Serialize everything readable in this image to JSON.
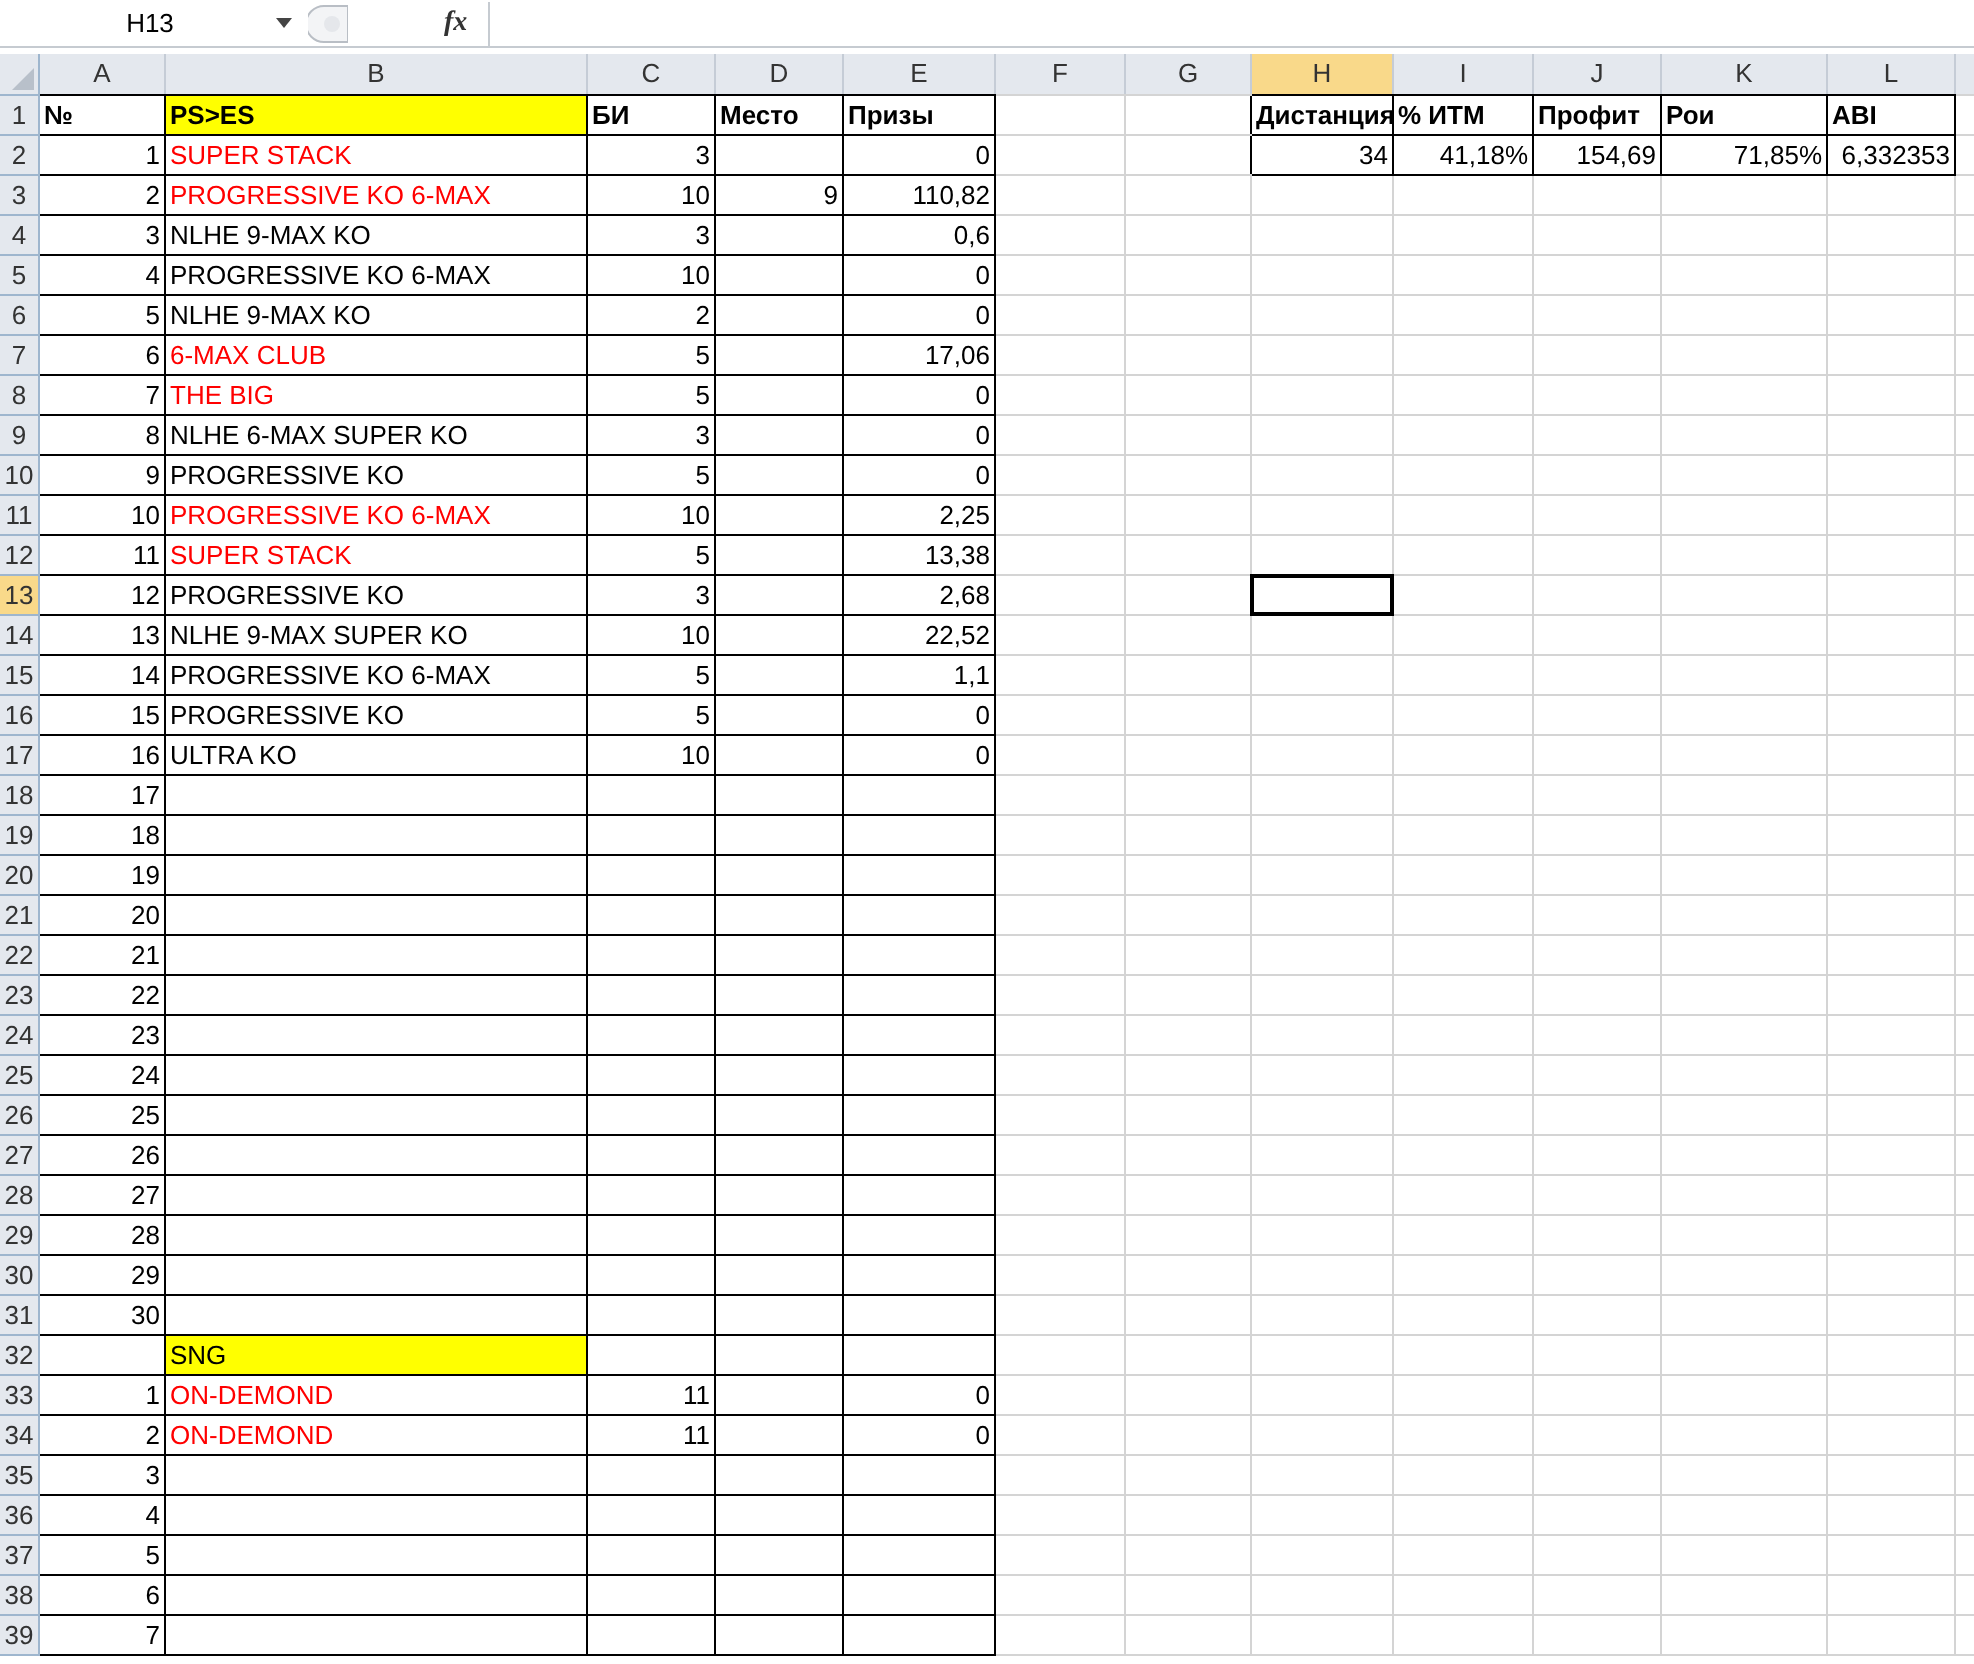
{
  "formula_bar": {
    "name_box": "H13",
    "function_label": "fx"
  },
  "columns": [
    {
      "label": "A",
      "selected": false
    },
    {
      "label": "B",
      "selected": false
    },
    {
      "label": "C",
      "selected": false
    },
    {
      "label": "D",
      "selected": false
    },
    {
      "label": "E",
      "selected": false
    },
    {
      "label": "F",
      "selected": false
    },
    {
      "label": "G",
      "selected": false
    },
    {
      "label": "H",
      "selected": true
    },
    {
      "label": "I",
      "selected": false
    },
    {
      "label": "J",
      "selected": false
    },
    {
      "label": "K",
      "selected": false
    },
    {
      "label": "L",
      "selected": false
    }
  ],
  "rows": [
    {
      "number": "1",
      "selected": false,
      "cells": [
        {
          "kind": "text",
          "text": "№",
          "bold": true
        },
        {
          "kind": "text",
          "text": "PS>ES",
          "bold": true,
          "highlighted": true
        },
        {
          "kind": "text",
          "text": "БИ",
          "bold": true
        },
        {
          "kind": "text",
          "text": "Место",
          "bold": true
        },
        {
          "kind": "text",
          "text": "Призы",
          "bold": true
        }
      ],
      "summary_cells": [
        {
          "kind": "text",
          "text": "Дистанция",
          "bold": true
        },
        {
          "kind": "text",
          "text": "% ИТМ",
          "bold": true
        },
        {
          "kind": "text",
          "text": "Профит",
          "bold": true
        },
        {
          "kind": "text",
          "text": "Рои",
          "bold": true
        },
        {
          "kind": "text",
          "text": "ABI",
          "bold": true
        }
      ]
    },
    {
      "number": "2",
      "selected": false,
      "cells": [
        {
          "kind": "number",
          "text": "1"
        },
        {
          "kind": "text",
          "text": "SUPER STACK",
          "color": "#ff0000"
        },
        {
          "kind": "number",
          "text": "3"
        },
        {
          "kind": "empty"
        },
        {
          "kind": "number",
          "text": "0"
        }
      ],
      "summary_cells": [
        {
          "kind": "number",
          "text": "34"
        },
        {
          "kind": "number",
          "text": "41,18%"
        },
        {
          "kind": "number",
          "text": "154,69"
        },
        {
          "kind": "number",
          "text": "71,85%"
        },
        {
          "kind": "number",
          "text": "6,332353"
        }
      ]
    },
    {
      "number": "3",
      "selected": false,
      "cells": [
        {
          "kind": "number",
          "text": "2"
        },
        {
          "kind": "text",
          "text": "PROGRESSIVE KO 6-MAX",
          "color": "#ff0000"
        },
        {
          "kind": "number",
          "text": "10"
        },
        {
          "kind": "number",
          "text": "9"
        },
        {
          "kind": "number",
          "text": "110,82"
        }
      ]
    },
    {
      "number": "4",
      "selected": false,
      "cells": [
        {
          "kind": "number",
          "text": "3"
        },
        {
          "kind": "text",
          "text": "NLHE 9-MAX KO"
        },
        {
          "kind": "number",
          "text": "3"
        },
        {
          "kind": "empty"
        },
        {
          "kind": "number",
          "text": "0,6"
        }
      ]
    },
    {
      "number": "5",
      "selected": false,
      "cells": [
        {
          "kind": "number",
          "text": "4"
        },
        {
          "kind": "text",
          "text": "PROGRESSIVE KO 6-MAX"
        },
        {
          "kind": "number",
          "text": "10"
        },
        {
          "kind": "empty"
        },
        {
          "kind": "number",
          "text": "0"
        }
      ]
    },
    {
      "number": "6",
      "selected": false,
      "cells": [
        {
          "kind": "number",
          "text": "5"
        },
        {
          "kind": "text",
          "text": "NLHE 9-MAX KO"
        },
        {
          "kind": "number",
          "text": "2"
        },
        {
          "kind": "empty"
        },
        {
          "kind": "number",
          "text": "0"
        }
      ]
    },
    {
      "number": "7",
      "selected": false,
      "cells": [
        {
          "kind": "number",
          "text": "6"
        },
        {
          "kind": "text",
          "text": "6-MAX CLUB",
          "color": "#ff0000"
        },
        {
          "kind": "number",
          "text": "5"
        },
        {
          "kind": "empty"
        },
        {
          "kind": "number",
          "text": "17,06"
        }
      ]
    },
    {
      "number": "8",
      "selected": false,
      "cells": [
        {
          "kind": "number",
          "text": "7"
        },
        {
          "kind": "text",
          "text": "THE BIG",
          "color": "#ff0000"
        },
        {
          "kind": "number",
          "text": "5"
        },
        {
          "kind": "empty"
        },
        {
          "kind": "number",
          "text": "0"
        }
      ]
    },
    {
      "number": "9",
      "selected": false,
      "cells": [
        {
          "kind": "number",
          "text": "8"
        },
        {
          "kind": "text",
          "text": "NLHE 6-MAX SUPER KO"
        },
        {
          "kind": "number",
          "text": "3"
        },
        {
          "kind": "empty"
        },
        {
          "kind": "number",
          "text": "0"
        }
      ]
    },
    {
      "number": "10",
      "selected": false,
      "cells": [
        {
          "kind": "number",
          "text": "9"
        },
        {
          "kind": "text",
          "text": "PROGRESSIVE KO"
        },
        {
          "kind": "number",
          "text": "5"
        },
        {
          "kind": "empty"
        },
        {
          "kind": "number",
          "text": "0"
        }
      ]
    },
    {
      "number": "11",
      "selected": false,
      "cells": [
        {
          "kind": "number",
          "text": "10"
        },
        {
          "kind": "text",
          "text": "PROGRESSIVE KO 6-MAX",
          "color": "#ff0000"
        },
        {
          "kind": "number",
          "text": "10"
        },
        {
          "kind": "empty"
        },
        {
          "kind": "number",
          "text": "2,25"
        }
      ]
    },
    {
      "number": "12",
      "selected": false,
      "cells": [
        {
          "kind": "number",
          "text": "11"
        },
        {
          "kind": "text",
          "text": "SUPER STACK",
          "color": "#ff0000"
        },
        {
          "kind": "number",
          "text": "5"
        },
        {
          "kind": "empty"
        },
        {
          "kind": "number",
          "text": "13,38"
        }
      ]
    },
    {
      "number": "13",
      "selected": true,
      "cells": [
        {
          "kind": "number",
          "text": "12"
        },
        {
          "kind": "text",
          "text": "PROGRESSIVE KO"
        },
        {
          "kind": "number",
          "text": "3"
        },
        {
          "kind": "empty"
        },
        {
          "kind": "number",
          "text": "2,68"
        }
      ]
    },
    {
      "number": "14",
      "selected": false,
      "cells": [
        {
          "kind": "number",
          "text": "13"
        },
        {
          "kind": "text",
          "text": "NLHE 9-MAX SUPER KO"
        },
        {
          "kind": "number",
          "text": "10"
        },
        {
          "kind": "empty"
        },
        {
          "kind": "number",
          "text": "22,52"
        }
      ]
    },
    {
      "number": "15",
      "selected": false,
      "cells": [
        {
          "kind": "number",
          "text": "14"
        },
        {
          "kind": "text",
          "text": "PROGRESSIVE KO 6-MAX"
        },
        {
          "kind": "number",
          "text": "5"
        },
        {
          "kind": "empty"
        },
        {
          "kind": "number",
          "text": "1,1"
        }
      ]
    },
    {
      "number": "16",
      "selected": false,
      "cells": [
        {
          "kind": "number",
          "text": "15"
        },
        {
          "kind": "text",
          "text": "PROGRESSIVE KO"
        },
        {
          "kind": "number",
          "text": "5"
        },
        {
          "kind": "empty"
        },
        {
          "kind": "number",
          "text": "0"
        }
      ]
    },
    {
      "number": "17",
      "selected": false,
      "cells": [
        {
          "kind": "number",
          "text": "16"
        },
        {
          "kind": "text",
          "text": "ULTRA KO"
        },
        {
          "kind": "number",
          "text": "10"
        },
        {
          "kind": "empty"
        },
        {
          "kind": "number",
          "text": "0"
        }
      ]
    },
    {
      "number": "18",
      "selected": false,
      "cells": [
        {
          "kind": "number",
          "text": "17"
        },
        {
          "kind": "empty"
        },
        {
          "kind": "empty"
        },
        {
          "kind": "empty"
        },
        {
          "kind": "empty"
        }
      ]
    },
    {
      "number": "19",
      "selected": false,
      "cells": [
        {
          "kind": "number",
          "text": "18"
        },
        {
          "kind": "empty"
        },
        {
          "kind": "empty"
        },
        {
          "kind": "empty"
        },
        {
          "kind": "empty"
        }
      ]
    },
    {
      "number": "20",
      "selected": false,
      "cells": [
        {
          "kind": "number",
          "text": "19"
        },
        {
          "kind": "empty"
        },
        {
          "kind": "empty"
        },
        {
          "kind": "empty"
        },
        {
          "kind": "empty"
        }
      ]
    },
    {
      "number": "21",
      "selected": false,
      "cells": [
        {
          "kind": "number",
          "text": "20"
        },
        {
          "kind": "empty"
        },
        {
          "kind": "empty"
        },
        {
          "kind": "empty"
        },
        {
          "kind": "empty"
        }
      ]
    },
    {
      "number": "22",
      "selected": false,
      "cells": [
        {
          "kind": "number",
          "text": "21"
        },
        {
          "kind": "empty"
        },
        {
          "kind": "empty"
        },
        {
          "kind": "empty"
        },
        {
          "kind": "empty"
        }
      ]
    },
    {
      "number": "23",
      "selected": false,
      "cells": [
        {
          "kind": "number",
          "text": "22"
        },
        {
          "kind": "empty"
        },
        {
          "kind": "empty"
        },
        {
          "kind": "empty"
        },
        {
          "kind": "empty"
        }
      ]
    },
    {
      "number": "24",
      "selected": false,
      "cells": [
        {
          "kind": "number",
          "text": "23"
        },
        {
          "kind": "empty"
        },
        {
          "kind": "empty"
        },
        {
          "kind": "empty"
        },
        {
          "kind": "empty"
        }
      ]
    },
    {
      "number": "25",
      "selected": false,
      "cells": [
        {
          "kind": "number",
          "text": "24"
        },
        {
          "kind": "empty"
        },
        {
          "kind": "empty"
        },
        {
          "kind": "empty"
        },
        {
          "kind": "empty"
        }
      ]
    },
    {
      "number": "26",
      "selected": false,
      "cells": [
        {
          "kind": "number",
          "text": "25"
        },
        {
          "kind": "empty"
        },
        {
          "kind": "empty"
        },
        {
          "kind": "empty"
        },
        {
          "kind": "empty"
        }
      ]
    },
    {
      "number": "27",
      "selected": false,
      "cells": [
        {
          "kind": "number",
          "text": "26"
        },
        {
          "kind": "empty"
        },
        {
          "kind": "empty"
        },
        {
          "kind": "empty"
        },
        {
          "kind": "empty"
        }
      ]
    },
    {
      "number": "28",
      "selected": false,
      "cells": [
        {
          "kind": "number",
          "text": "27"
        },
        {
          "kind": "empty"
        },
        {
          "kind": "empty"
        },
        {
          "kind": "empty"
        },
        {
          "kind": "empty"
        }
      ]
    },
    {
      "number": "29",
      "selected": false,
      "cells": [
        {
          "kind": "number",
          "text": "28"
        },
        {
          "kind": "empty"
        },
        {
          "kind": "empty"
        },
        {
          "kind": "empty"
        },
        {
          "kind": "empty"
        }
      ]
    },
    {
      "number": "30",
      "selected": false,
      "cells": [
        {
          "kind": "number",
          "text": "29"
        },
        {
          "kind": "empty"
        },
        {
          "kind": "empty"
        },
        {
          "kind": "empty"
        },
        {
          "kind": "empty"
        }
      ]
    },
    {
      "number": "31",
      "selected": false,
      "cells": [
        {
          "kind": "number",
          "text": "30"
        },
        {
          "kind": "empty"
        },
        {
          "kind": "empty"
        },
        {
          "kind": "empty"
        },
        {
          "kind": "empty"
        }
      ]
    },
    {
      "number": "32",
      "selected": false,
      "cells": [
        {
          "kind": "empty"
        },
        {
          "kind": "text",
          "text": "SNG",
          "highlighted": true
        },
        {
          "kind": "empty"
        },
        {
          "kind": "empty"
        },
        {
          "kind": "empty"
        }
      ]
    },
    {
      "number": "33",
      "selected": false,
      "cells": [
        {
          "kind": "number",
          "text": "1"
        },
        {
          "kind": "text",
          "text": "ON-DEMOND",
          "color": "#ff0000"
        },
        {
          "kind": "number",
          "text": "11"
        },
        {
          "kind": "empty"
        },
        {
          "kind": "number",
          "text": "0"
        }
      ]
    },
    {
      "number": "34",
      "selected": false,
      "cells": [
        {
          "kind": "number",
          "text": "2"
        },
        {
          "kind": "text",
          "text": "ON-DEMOND",
          "color": "#ff0000"
        },
        {
          "kind": "number",
          "text": "11"
        },
        {
          "kind": "empty"
        },
        {
          "kind": "number",
          "text": "0"
        }
      ]
    },
    {
      "number": "35",
      "selected": false,
      "cells": [
        {
          "kind": "number",
          "text": "3"
        },
        {
          "kind": "empty"
        },
        {
          "kind": "empty"
        },
        {
          "kind": "empty"
        },
        {
          "kind": "empty"
        }
      ]
    },
    {
      "number": "36",
      "selected": false,
      "cells": [
        {
          "kind": "number",
          "text": "4"
        },
        {
          "kind": "empty"
        },
        {
          "kind": "empty"
        },
        {
          "kind": "empty"
        },
        {
          "kind": "empty"
        }
      ]
    },
    {
      "number": "37",
      "selected": false,
      "cells": [
        {
          "kind": "number",
          "text": "5"
        },
        {
          "kind": "empty"
        },
        {
          "kind": "empty"
        },
        {
          "kind": "empty"
        },
        {
          "kind": "empty"
        }
      ]
    },
    {
      "number": "38",
      "selected": false,
      "cells": [
        {
          "kind": "number",
          "text": "6"
        },
        {
          "kind": "empty"
        },
        {
          "kind": "empty"
        },
        {
          "kind": "empty"
        },
        {
          "kind": "empty"
        }
      ]
    },
    {
      "number": "39",
      "selected": false,
      "cells": [
        {
          "kind": "number",
          "text": "7"
        },
        {
          "kind": "empty"
        },
        {
          "kind": "empty"
        },
        {
          "kind": "empty"
        },
        {
          "kind": "empty"
        }
      ]
    }
  ]
}
